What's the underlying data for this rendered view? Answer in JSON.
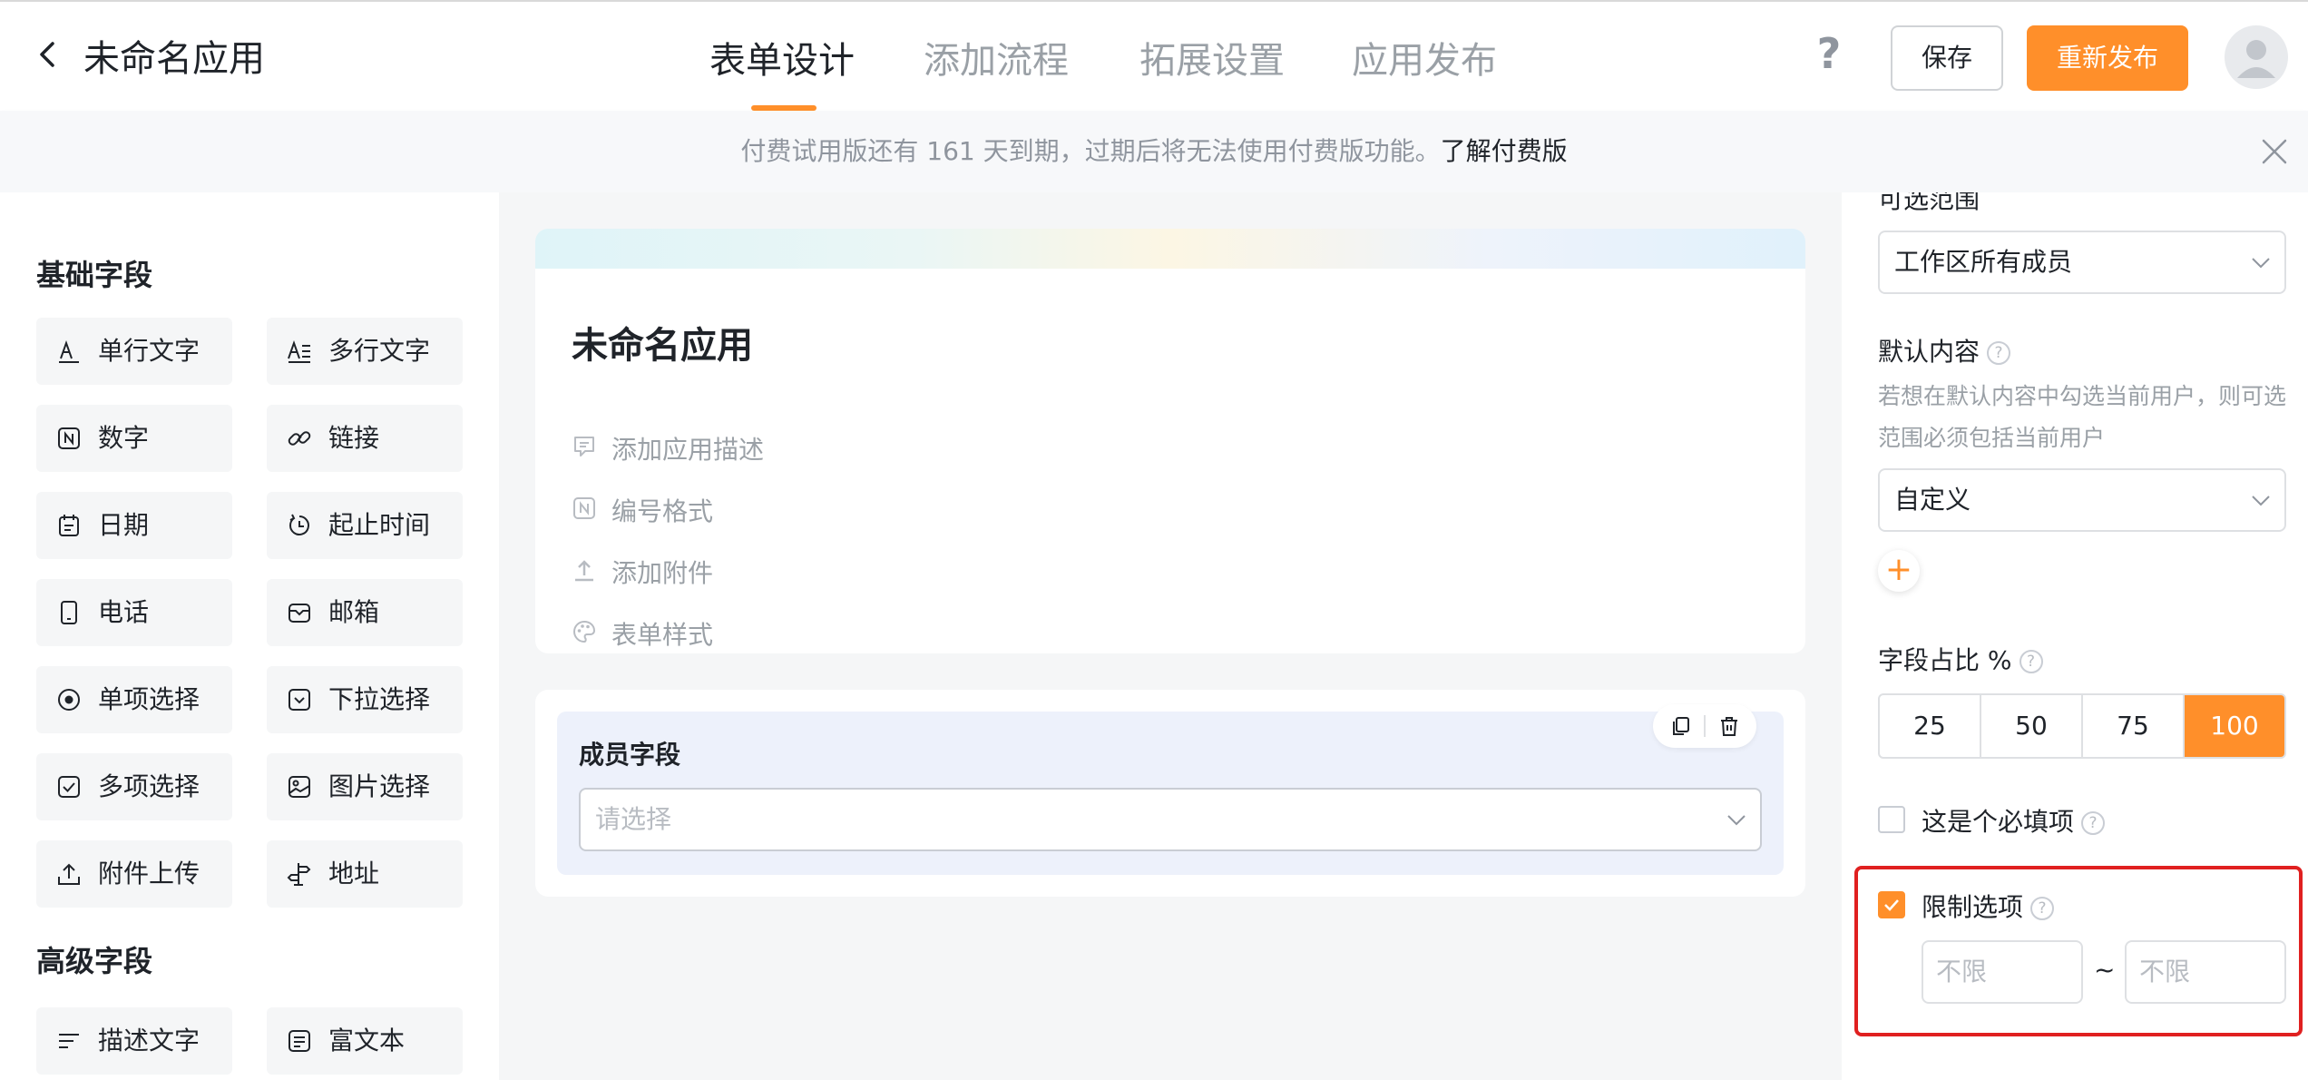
{
  "header": {
    "app_title": "未命名应用",
    "tabs": [
      {
        "label": "表单设计",
        "active": true
      },
      {
        "label": "添加流程",
        "active": false
      },
      {
        "label": "拓展设置",
        "active": false
      },
      {
        "label": "应用发布",
        "active": false
      }
    ],
    "help_label": "?",
    "save_label": "保存",
    "publish_label": "重新发布",
    "accent_color": "#ff8f2a"
  },
  "notice": {
    "text": "付费试用版还有 161 天到期，过期后将无法使用付费版功能。",
    "link": "了解付费版"
  },
  "palette": {
    "basic_title": "基础字段",
    "basic_fields": [
      {
        "label": "单行文字",
        "icon": "single-line-text-icon"
      },
      {
        "label": "多行文字",
        "icon": "multi-line-text-icon"
      },
      {
        "label": "数字",
        "icon": "number-icon"
      },
      {
        "label": "链接",
        "icon": "link-icon"
      },
      {
        "label": "日期",
        "icon": "calendar-icon"
      },
      {
        "label": "起止时间",
        "icon": "time-range-icon"
      },
      {
        "label": "电话",
        "icon": "phone-icon"
      },
      {
        "label": "邮箱",
        "icon": "mail-icon"
      },
      {
        "label": "单项选择",
        "icon": "radio-icon"
      },
      {
        "label": "下拉选择",
        "icon": "dropdown-icon"
      },
      {
        "label": "多项选择",
        "icon": "checkbox-icon"
      },
      {
        "label": "图片选择",
        "icon": "image-icon"
      },
      {
        "label": "附件上传",
        "icon": "upload-icon"
      },
      {
        "label": "地址",
        "icon": "signpost-icon"
      }
    ],
    "advanced_title": "高级字段",
    "advanced_fields": [
      {
        "label": "描述文字",
        "icon": "description-icon"
      },
      {
        "label": "富文本",
        "icon": "rich-text-icon"
      }
    ]
  },
  "form": {
    "title": "未命名应用",
    "options": [
      {
        "label": "添加应用描述",
        "icon": "comment-icon"
      },
      {
        "label": "编号格式",
        "icon": "number-format-icon"
      },
      {
        "label": "添加附件",
        "icon": "attachment-upload-icon"
      },
      {
        "label": "表单样式",
        "icon": "palette-icon"
      }
    ],
    "member_field": {
      "label": "成员字段",
      "placeholder": "请选择"
    }
  },
  "props": {
    "range_label": "可选范围",
    "range_value": "工作区所有成员",
    "default_label": "默认内容",
    "default_hint": "若想在默认内容中勾选当前用户，则可选范围必须包括当前用户",
    "default_value": "自定义",
    "add_symbol": "+",
    "width_label": "字段占比 %",
    "width_options": [
      "25",
      "50",
      "75",
      "100"
    ],
    "width_selected": "100",
    "required_label": "这是个必填项",
    "required_checked": false,
    "limit_label": "限制选项",
    "limit_checked": true,
    "limit_min_placeholder": "不限",
    "limit_max_placeholder": "不限",
    "limit_separator": "~"
  }
}
